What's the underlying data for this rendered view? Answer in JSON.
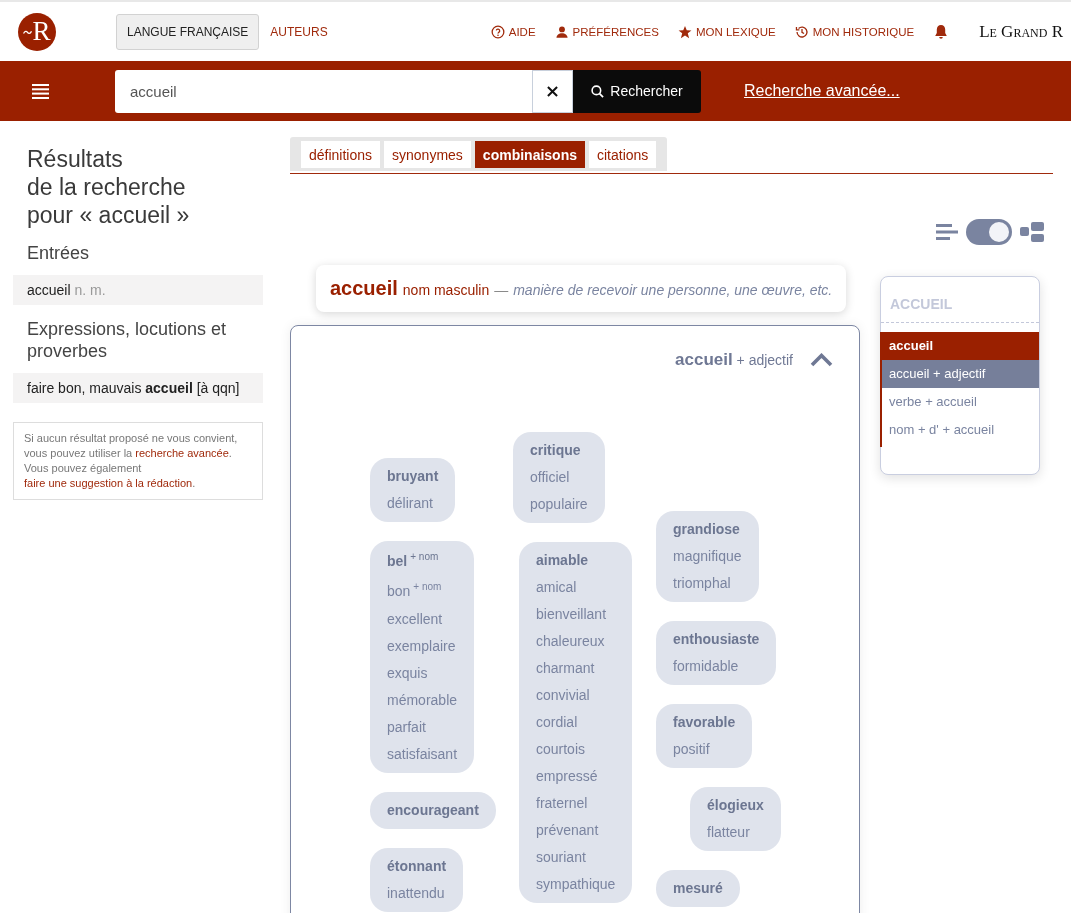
{
  "header": {
    "logo": {
      "letter": "R"
    },
    "language_button": "LANGUE FRANÇAISE",
    "authors_link": "AUTEURS",
    "nav": [
      {
        "kind": "help",
        "label": "AIDE"
      },
      {
        "kind": "preferences",
        "label": "PRÉFÉRENCES"
      },
      {
        "kind": "lexicon",
        "label": "MON LEXIQUE"
      },
      {
        "kind": "history",
        "label": "MON HISTORIQUE"
      },
      {
        "kind": "notifications"
      }
    ],
    "brand": "Le Grand R"
  },
  "search": {
    "value": "accueil",
    "submit": "Rechercher",
    "advanced_link": "Recherche avancée..."
  },
  "results": {
    "title": "Résultats\nde la recherche\npour « accueil »",
    "sections": [
      {
        "heading": "Entrées",
        "items": [
          {
            "text": "accueil",
            "note": "n. m."
          }
        ]
      },
      {
        "heading": "Expressions, locutions et proverbes",
        "items": [
          {
            "text": "faire bon, mauvais **accueil** [à qqn]"
          }
        ]
      }
    ],
    "notice": [
      {
        "kind": "text",
        "text": "Si aucun résultat proposé ne vous convient, vous pouvez utiliser la "
      },
      {
        "kind": "link",
        "text": "recherche avancée"
      },
      {
        "kind": "text",
        "text": ". Vous pouvez également "
      },
      {
        "kind": "link",
        "text": "faire une suggestion à la rédaction"
      },
      {
        "kind": "text",
        "text": "."
      }
    ]
  },
  "tabs": [
    {
      "label": "définitions",
      "selected": false
    },
    {
      "label": "synonymes",
      "selected": false
    },
    {
      "label": "combinaisons",
      "selected": true
    },
    {
      "label": "citations",
      "selected": false
    }
  ],
  "view_toggle": {
    "on": true
  },
  "definition": {
    "word": "accueil",
    "category": "nom masculin",
    "separator": "—",
    "gloss": "manière de recevoir une personne, une œuvre, etc."
  },
  "combinations": {
    "title": "**accueil** + adjectif",
    "expanded": true,
    "columns": [
      [
        {
          "words": [
            "bruyant",
            "délirant"
          ]
        },
        {
          "words": [
            "bel$^{+ nom}$",
            "bon$^{+ nom}$",
            "excellent",
            "exemplaire",
            "exquis",
            "mémorable",
            "parfait",
            "satisfaisant"
          ]
        },
        {
          "words": [
            "encourageant"
          ]
        },
        {
          "words": [
            "étonnant",
            "inattendu"
          ]
        }
      ],
      [
        {
          "words": [
            "critique",
            "officiel",
            "populaire"
          ]
        },
        {
          "words": [
            "aimable",
            "amical",
            "bienveillant",
            "chaleureux",
            "charmant",
            "convivial",
            "cordial",
            "courtois",
            "empressé",
            "fraternel",
            "prévenant",
            "souriant",
            "sympathique"
          ]
        }
      ],
      [
        {
          "words": [
            "grandiose",
            "magnifique",
            "triomphal"
          ]
        },
        {
          "words": [
            "enthousiaste",
            "formidable"
          ]
        },
        {
          "words": [
            "favorable",
            "positif"
          ]
        },
        {
          "words": [
            "élogieux",
            "flatteur"
          ]
        },
        {
          "words": [
            "mesuré"
          ]
        }
      ]
    ]
  },
  "menu": {
    "heading": "ACCUEIL",
    "sections": [
      {
        "label": "accueil",
        "selected": true,
        "children": [
          {
            "label": "accueil + adjectif",
            "selected": true
          },
          {
            "label": "verbe + accueil",
            "selected": false
          },
          {
            "label": "nom + d' + accueil",
            "selected": false
          }
        ]
      }
    ]
  }
}
